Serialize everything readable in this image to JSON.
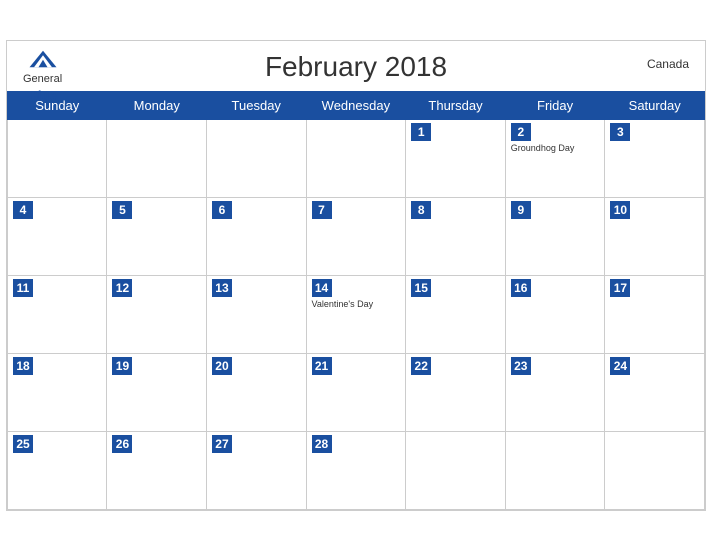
{
  "header": {
    "logo_general": "General",
    "logo_blue": "Blue",
    "title": "February 2018",
    "country": "Canada"
  },
  "weekdays": [
    "Sunday",
    "Monday",
    "Tuesday",
    "Wednesday",
    "Thursday",
    "Friday",
    "Saturday"
  ],
  "weeks": [
    [
      {
        "day": "",
        "holiday": ""
      },
      {
        "day": "",
        "holiday": ""
      },
      {
        "day": "",
        "holiday": ""
      },
      {
        "day": "",
        "holiday": ""
      },
      {
        "day": "1",
        "holiday": ""
      },
      {
        "day": "2",
        "holiday": "Groundhog Day"
      },
      {
        "day": "3",
        "holiday": ""
      }
    ],
    [
      {
        "day": "4",
        "holiday": ""
      },
      {
        "day": "5",
        "holiday": ""
      },
      {
        "day": "6",
        "holiday": ""
      },
      {
        "day": "7",
        "holiday": ""
      },
      {
        "day": "8",
        "holiday": ""
      },
      {
        "day": "9",
        "holiday": ""
      },
      {
        "day": "10",
        "holiday": ""
      }
    ],
    [
      {
        "day": "11",
        "holiday": ""
      },
      {
        "day": "12",
        "holiday": ""
      },
      {
        "day": "13",
        "holiday": ""
      },
      {
        "day": "14",
        "holiday": "Valentine's Day"
      },
      {
        "day": "15",
        "holiday": ""
      },
      {
        "day": "16",
        "holiday": ""
      },
      {
        "day": "17",
        "holiday": ""
      }
    ],
    [
      {
        "day": "18",
        "holiday": ""
      },
      {
        "day": "19",
        "holiday": ""
      },
      {
        "day": "20",
        "holiday": ""
      },
      {
        "day": "21",
        "holiday": ""
      },
      {
        "day": "22",
        "holiday": ""
      },
      {
        "day": "23",
        "holiday": ""
      },
      {
        "day": "24",
        "holiday": ""
      }
    ],
    [
      {
        "day": "25",
        "holiday": ""
      },
      {
        "day": "26",
        "holiday": ""
      },
      {
        "day": "27",
        "holiday": ""
      },
      {
        "day": "28",
        "holiday": ""
      },
      {
        "day": "",
        "holiday": ""
      },
      {
        "day": "",
        "holiday": ""
      },
      {
        "day": "",
        "holiday": ""
      }
    ]
  ]
}
